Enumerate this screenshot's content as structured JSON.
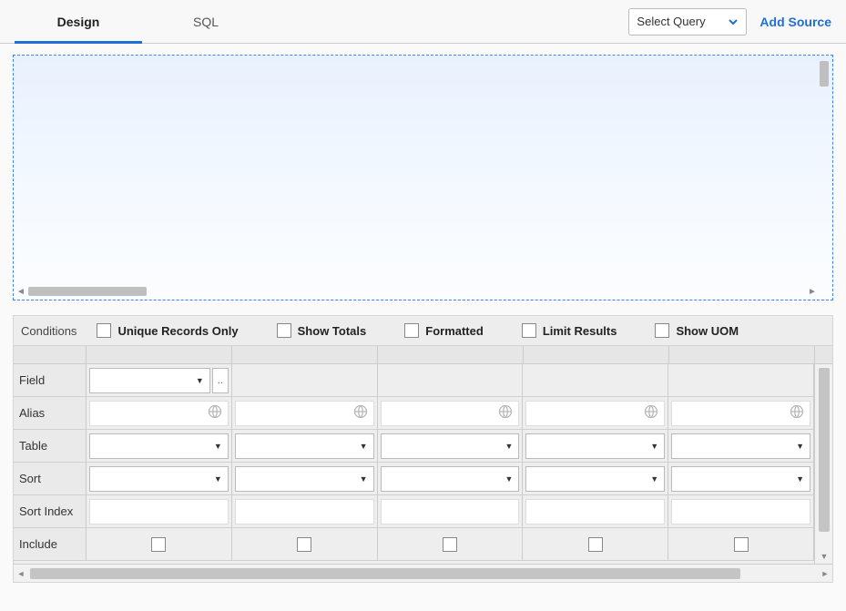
{
  "tabs": {
    "design": "Design",
    "sql": "SQL",
    "active": "design"
  },
  "topbar": {
    "select_query": "Select Query",
    "add_source": "Add Source"
  },
  "conditions": {
    "label": "Conditions",
    "unique": "Unique Records Only",
    "totals": "Show Totals",
    "formatted": "Formatted",
    "limit": "Limit Results",
    "uom": "Show UOM"
  },
  "rows": {
    "field": "Field",
    "alias": "Alias",
    "table": "Table",
    "sort": "Sort",
    "sort_index": "Sort Index",
    "include": "Include"
  },
  "columns": 5,
  "field_more": ".."
}
